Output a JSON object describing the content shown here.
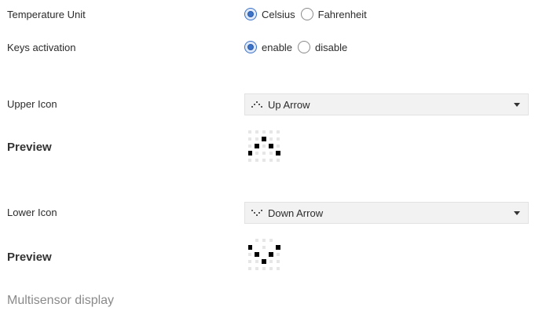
{
  "temperature_unit": {
    "label": "Temperature Unit",
    "options": [
      "Celsius",
      "Fahrenheit"
    ],
    "selected": "Celsius"
  },
  "keys_activation": {
    "label": "Keys activation",
    "options": [
      "enable",
      "disable"
    ],
    "selected": "enable"
  },
  "upper_icon": {
    "label": "Upper Icon",
    "value": "Up Arrow",
    "preview_label": "Preview",
    "icon": "up-arrow-icon"
  },
  "lower_icon": {
    "label": "Lower Icon",
    "value": "Down Arrow",
    "preview_label": "Preview",
    "icon": "down-arrow-icon"
  },
  "footer": {
    "title": "Multisensor display"
  },
  "colors": {
    "radio_accent": "#3c73c8",
    "dropdown_bg": "#f2f2f2",
    "pixel_on": "#000000",
    "pixel_off": "#e6e6e6"
  }
}
